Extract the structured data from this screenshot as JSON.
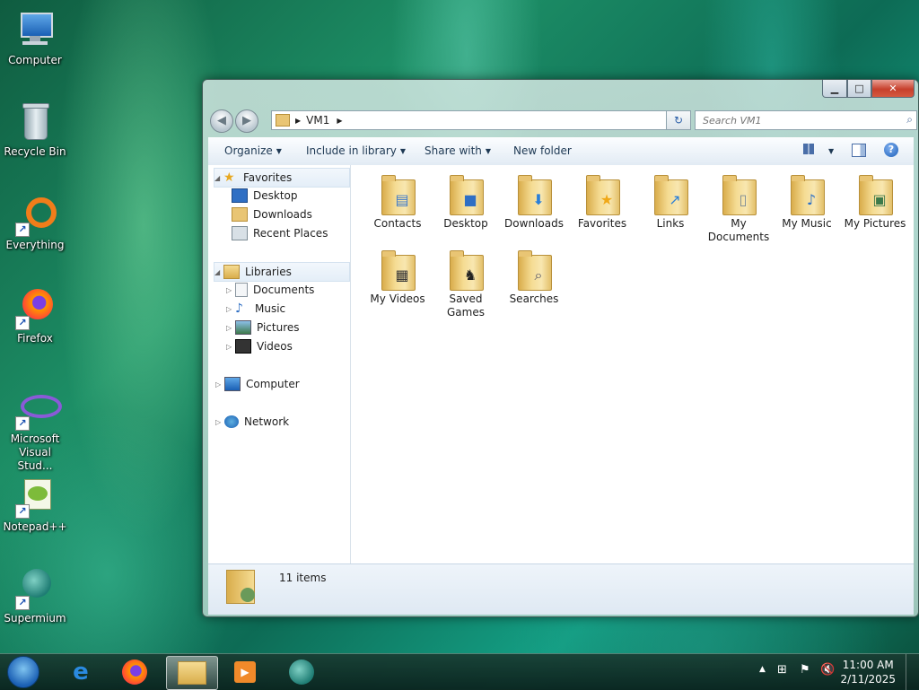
{
  "desktop": {
    "icons": [
      {
        "label": "Computer"
      },
      {
        "label": "Recycle Bin"
      },
      {
        "label": "Everything"
      },
      {
        "label": "Firefox"
      },
      {
        "label": "Microsoft Visual Stud..."
      },
      {
        "label": "Notepad++"
      },
      {
        "label": "Supermium"
      }
    ]
  },
  "window": {
    "address": {
      "segment": "VM1"
    },
    "search": {
      "placeholder": "Search VM1"
    },
    "toolbar": {
      "organize": "Organize",
      "include": "Include in library",
      "share": "Share with",
      "new_folder": "New folder"
    },
    "nav": {
      "favorites": "Favorites",
      "desktop": "Desktop",
      "downloads": "Downloads",
      "recent": "Recent Places",
      "libraries": "Libraries",
      "documents": "Documents",
      "music": "Music",
      "pictures": "Pictures",
      "videos": "Videos",
      "computer": "Computer",
      "network": "Network"
    },
    "items": [
      {
        "l1": "Contacts",
        "l2": ""
      },
      {
        "l1": "Desktop",
        "l2": ""
      },
      {
        "l1": "Downloads",
        "l2": ""
      },
      {
        "l1": "Favorites",
        "l2": ""
      },
      {
        "l1": "Links",
        "l2": ""
      },
      {
        "l1": "My",
        "l2": "Documents"
      },
      {
        "l1": "My Music",
        "l2": ""
      },
      {
        "l1": "My Pictures",
        "l2": ""
      },
      {
        "l1": "My Videos",
        "l2": ""
      },
      {
        "l1": "Saved",
        "l2": "Games"
      },
      {
        "l1": "Searches",
        "l2": ""
      }
    ],
    "status": {
      "count": "11 items"
    }
  },
  "taskbar": {
    "time": "11:00 AM",
    "date": "2/11/2025"
  },
  "colors": {
    "accent": "#1d8f66",
    "selection": "#e4eef8"
  }
}
